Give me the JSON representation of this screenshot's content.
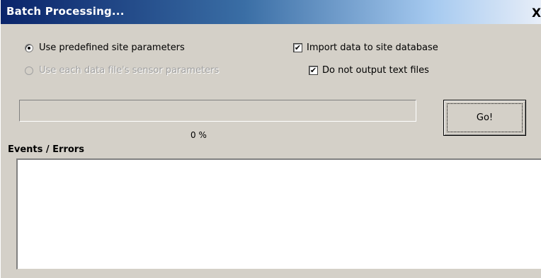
{
  "window": {
    "title": "Batch Processing...",
    "close_glyph": "X"
  },
  "options": {
    "radio_predefined": {
      "label": "Use predefined site parameters",
      "selected": true,
      "enabled": true
    },
    "radio_sensor": {
      "label": "Use each data file's sensor parameters",
      "selected": false,
      "enabled": false
    },
    "check_import": {
      "label": "Import data to site database",
      "checked": true
    },
    "check_no_text": {
      "label": "Do not output text files",
      "checked": true
    }
  },
  "progress": {
    "value_percent": 0,
    "text": "0 %"
  },
  "go_button": {
    "label": "Go!"
  },
  "events": {
    "label": "Events / Errors",
    "content": ""
  },
  "colors": {
    "dialog_face": "#d4d0c8",
    "titlebar_start": "#0a246a",
    "titlebar_end": "#a6caf0"
  }
}
